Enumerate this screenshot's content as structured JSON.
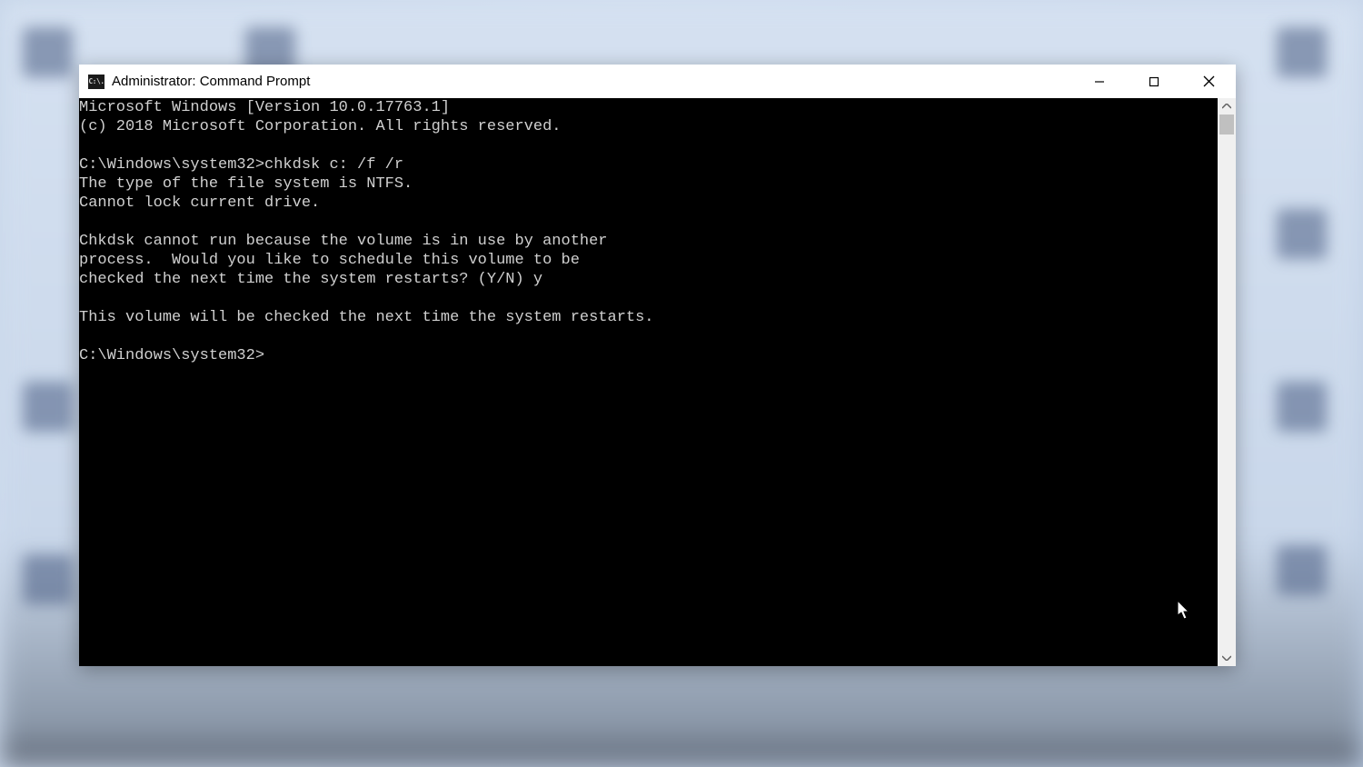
{
  "window": {
    "title": "Administrator: Command Prompt",
    "icon_text": "C:\\."
  },
  "terminal": {
    "lines": [
      "Microsoft Windows [Version 10.0.17763.1]",
      "(c) 2018 Microsoft Corporation. All rights reserved.",
      "",
      "C:\\Windows\\system32>chkdsk c: /f /r",
      "The type of the file system is NTFS.",
      "Cannot lock current drive.",
      "",
      "Chkdsk cannot run because the volume is in use by another",
      "process.  Would you like to schedule this volume to be",
      "checked the next time the system restarts? (Y/N) y",
      "",
      "This volume will be checked the next time the system restarts.",
      "",
      "C:\\Windows\\system32>"
    ]
  }
}
